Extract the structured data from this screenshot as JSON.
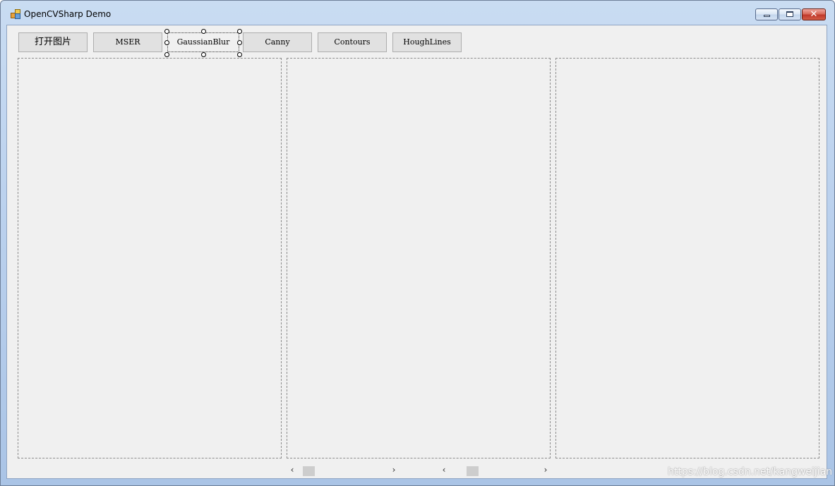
{
  "window": {
    "title": "OpenCVSharp Demo",
    "close_glyph": "✕"
  },
  "toolbar": {
    "buttons": [
      {
        "label": "打开图片"
      },
      {
        "label": "MSER"
      },
      {
        "label": "GaussianBlur"
      },
      {
        "label": "Canny"
      },
      {
        "label": "Contours"
      },
      {
        "label": "HoughLines"
      }
    ]
  },
  "scrollbars": {
    "left_arrow": "‹",
    "right_arrow": "›"
  },
  "watermark": "https://blog.csdn.net/kangweijian",
  "colors": {
    "client_background": "#f0f0f0",
    "button_background": "#e1e1e1",
    "panel_border": "#8c8c8c"
  }
}
